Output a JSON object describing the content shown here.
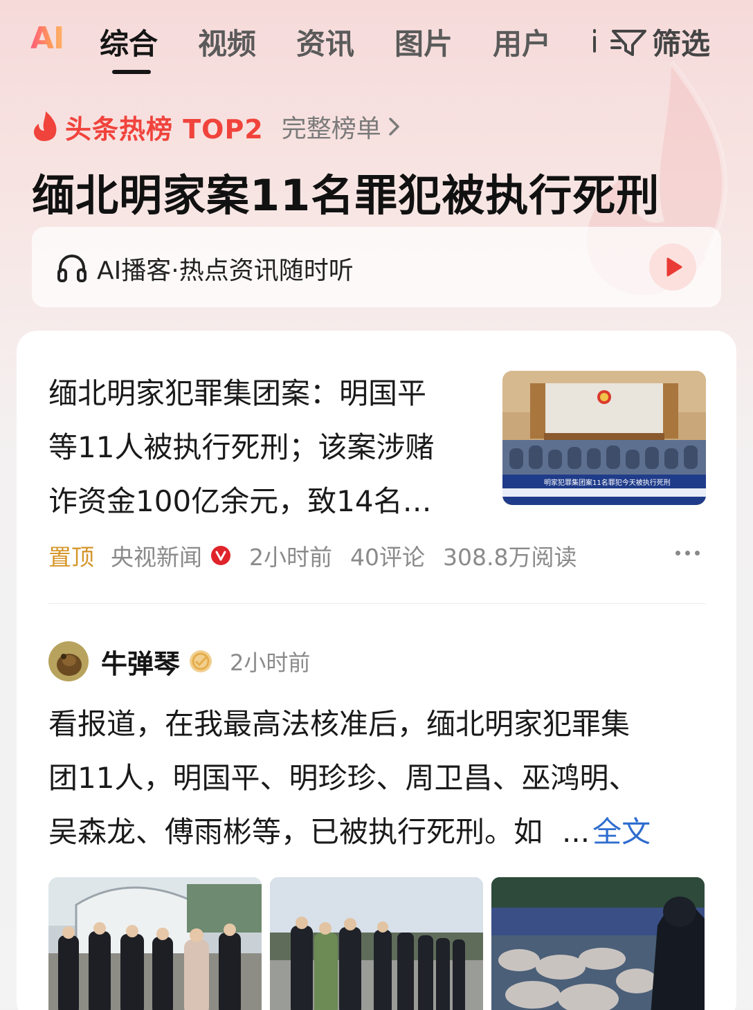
{
  "tabs": {
    "ai": "AI",
    "items": [
      {
        "label": "综合",
        "active": true
      },
      {
        "label": "视频",
        "active": false
      },
      {
        "label": "资讯",
        "active": false
      },
      {
        "label": "图片",
        "active": false
      },
      {
        "label": "用户",
        "active": false
      }
    ],
    "filter_label": "筛选"
  },
  "hot": {
    "label": "头条热榜 TOP2",
    "full_list": "完整榜单",
    "title": "缅北明家案11名罪犯被执行死刑"
  },
  "podcast": {
    "text": "AI播客·热点资讯随时听"
  },
  "news": {
    "title_lines": [
      "缅北明家犯罪集团案：明国平",
      "等11人被执行死刑；该案涉赌",
      "诈资金100亿余元，致14名…"
    ],
    "thumb_caption": "明家犯罪集团案11名罪犯今天被执行死刑",
    "pinned": "置顶",
    "source": "央视新闻",
    "time": "2小时前",
    "comments": "40评论",
    "reads": "308.8万阅读"
  },
  "post": {
    "username": "牛弹琴",
    "time": "2小时前",
    "lines": [
      "看报道，在我最高法核准后，缅北明家犯罪集",
      "团11人，明国平、明珍珍、周卫昌、巫鸿明、",
      "吴森龙、傅雨彬等，已被执行死刑。如"
    ],
    "ellipsis": "...",
    "full_text": "全文"
  },
  "colors": {
    "hot_red": "#f0433c",
    "pinned_gold": "#d6962a",
    "link_blue": "#2f6ecf",
    "verified_red": "#e0242b"
  }
}
